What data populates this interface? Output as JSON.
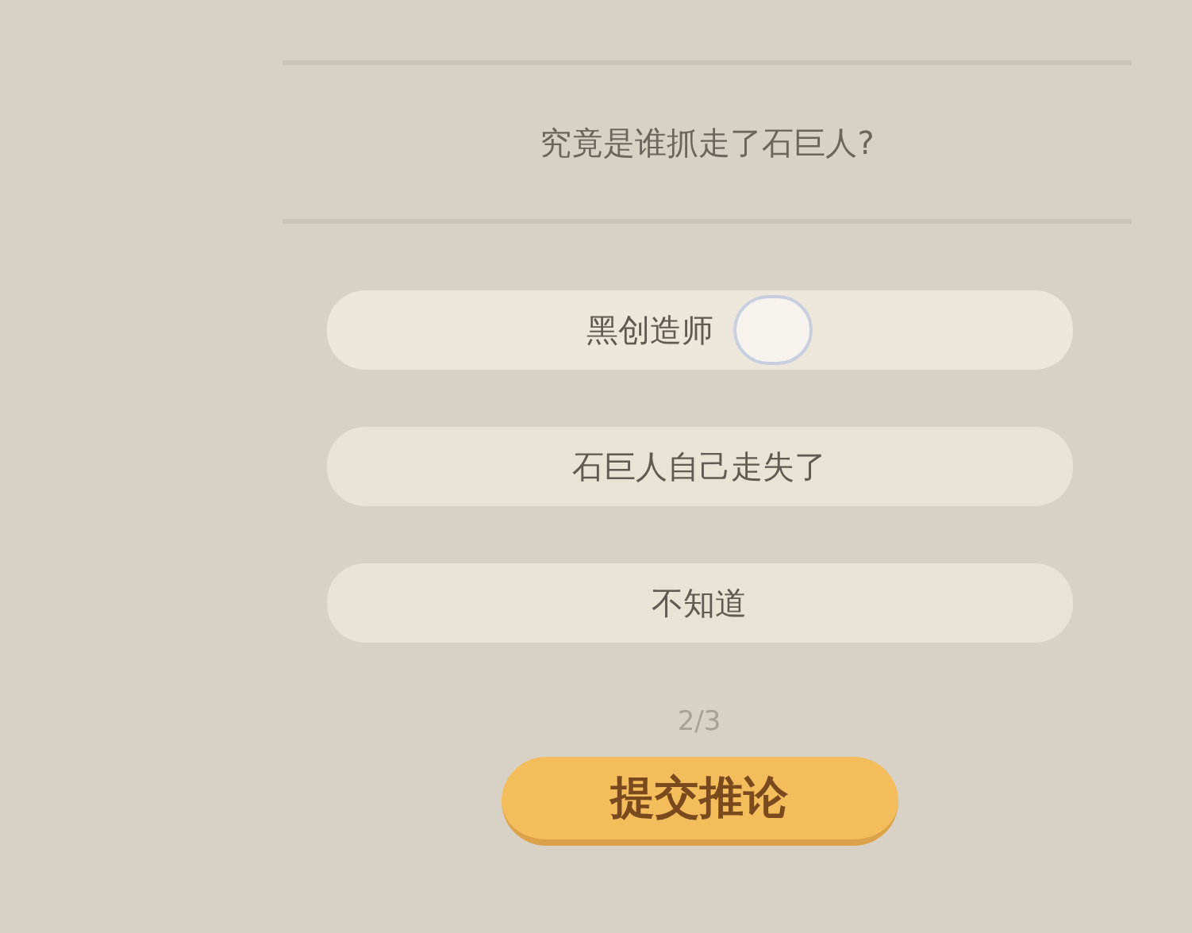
{
  "question": "究竟是谁抓走了石巨人?",
  "options": [
    {
      "label": "黑创造师",
      "selected": true
    },
    {
      "label": "石巨人自己走失了",
      "selected": false
    },
    {
      "label": "不知道",
      "selected": false
    }
  ],
  "progress": "2/3",
  "submit_button": "提交推论"
}
